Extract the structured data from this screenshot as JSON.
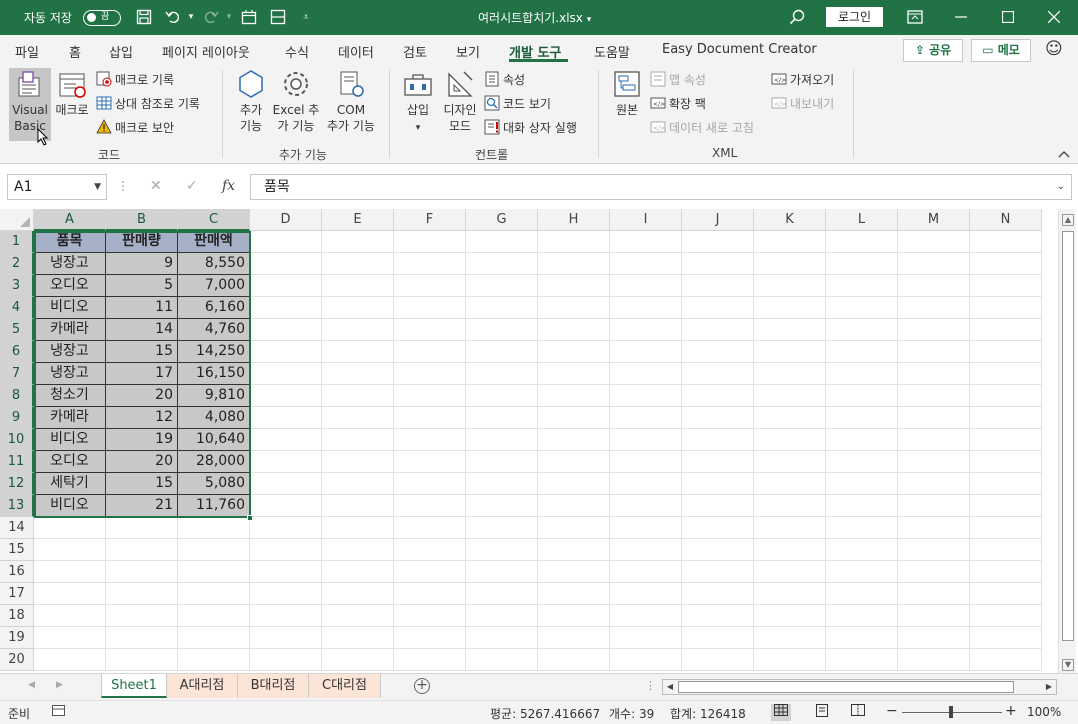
{
  "titlebar": {
    "autosave_label": "자동 저장",
    "autosave_state": "끔",
    "filename": "여러시트합치기.xlsx",
    "login": "로그인"
  },
  "tabs": [
    "파일",
    "홈",
    "삽입",
    "페이지 레이아웃",
    "수식",
    "데이터",
    "검토",
    "보기",
    "개발 도구",
    "도움말",
    "Easy Document Creator"
  ],
  "active_tab": "개발 도구",
  "share": "공유",
  "memo": "메모",
  "ribbon": {
    "code": {
      "label": "코드",
      "visual_basic": [
        "Visual",
        "Basic"
      ],
      "macro": "매크로",
      "record_macro": "매크로 기록",
      "relative_ref": "상대 참조로 기록",
      "macro_security": "매크로 보안"
    },
    "addins": {
      "label": "추가 기능",
      "addins_btn": [
        "추가",
        "기능"
      ],
      "excel_addins": [
        "Excel 추",
        "가 기능"
      ],
      "com_addins": [
        "COM",
        "추가 기능"
      ]
    },
    "controls": {
      "label": "컨트롤",
      "insert": "삽입",
      "design_mode": [
        "디자인",
        "모드"
      ],
      "properties": "속성",
      "view_code": "코드 보기",
      "run_dialog": "대화 상자 실행"
    },
    "xml": {
      "label": "XML",
      "source": "원본",
      "map_properties": "맵 속성",
      "expansion_packs": "확장 팩",
      "refresh_data": "데이터 새로 고침",
      "import": "가져오기",
      "export": "내보내기"
    }
  },
  "formula_bar": {
    "name_box": "A1",
    "formula": "품목"
  },
  "columns": [
    "A",
    "B",
    "C",
    "D",
    "E",
    "F",
    "G",
    "H",
    "I",
    "J",
    "K",
    "L",
    "M",
    "N"
  ],
  "rows": [
    "1",
    "2",
    "3",
    "4",
    "5",
    "6",
    "7",
    "8",
    "9",
    "10",
    "11",
    "12",
    "13",
    "14",
    "15",
    "16",
    "17",
    "18",
    "19",
    "20"
  ],
  "table": {
    "headers": [
      "품목",
      "판매량",
      "판매액"
    ],
    "rows": [
      [
        "냉장고",
        "9",
        "8,550"
      ],
      [
        "오디오",
        "5",
        "7,000"
      ],
      [
        "비디오",
        "11",
        "6,160"
      ],
      [
        "카메라",
        "14",
        "4,760"
      ],
      [
        "냉장고",
        "15",
        "14,250"
      ],
      [
        "냉장고",
        "17",
        "16,150"
      ],
      [
        "청소기",
        "20",
        "9,810"
      ],
      [
        "카메라",
        "12",
        "4,080"
      ],
      [
        "비디오",
        "19",
        "10,640"
      ],
      [
        "오디오",
        "20",
        "28,000"
      ],
      [
        "세탁기",
        "15",
        "5,080"
      ],
      [
        "비디오",
        "21",
        "11,760"
      ]
    ]
  },
  "sheets": [
    {
      "name": "Sheet1",
      "active": true
    },
    {
      "name": "A대리점",
      "active": false
    },
    {
      "name": "B대리점",
      "active": false
    },
    {
      "name": "C대리점",
      "active": false
    }
  ],
  "status": {
    "ready": "준비",
    "average": "평균: 5267.416667",
    "count": "개수: 39",
    "sum": "합계: 126418",
    "zoom": "100%"
  },
  "colors": {
    "accent": "#217346",
    "header_fill": "#a6b1c7",
    "data_fill": "#c8c8c8"
  }
}
